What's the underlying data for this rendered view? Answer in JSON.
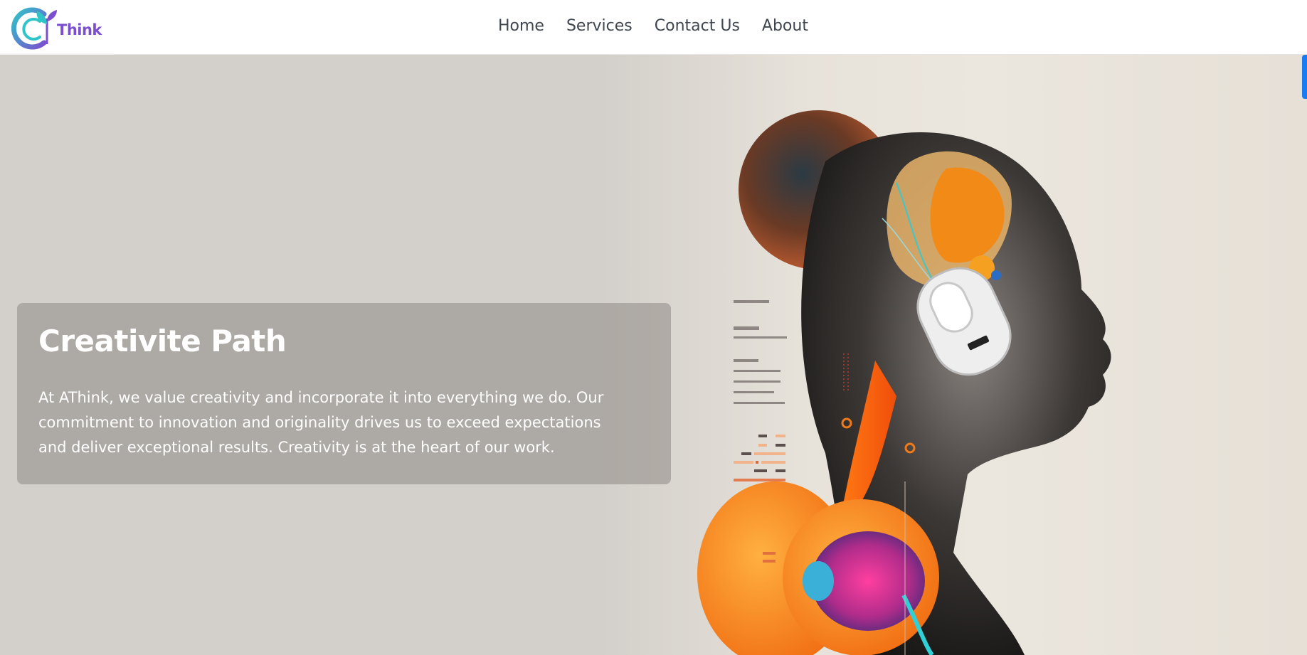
{
  "header": {
    "logo_text": "Think",
    "nav": [
      {
        "label": "Home"
      },
      {
        "label": "Services"
      },
      {
        "label": "Contact Us"
      },
      {
        "label": "About"
      }
    ]
  },
  "hero": {
    "title": "Creativite Path",
    "description": "At AThink, we value creativity and incorporate it into everything we do. Our commitment to innovation and originality drives us to exceed expectations and deliver exceptional results. Creativity is at the heart of our work."
  },
  "colors": {
    "brand_purple": "#7a4fd0",
    "brand_teal": "#2ec4c8",
    "accent_orange": "#f07a1a",
    "scroll_blue": "#1a7cf2"
  }
}
